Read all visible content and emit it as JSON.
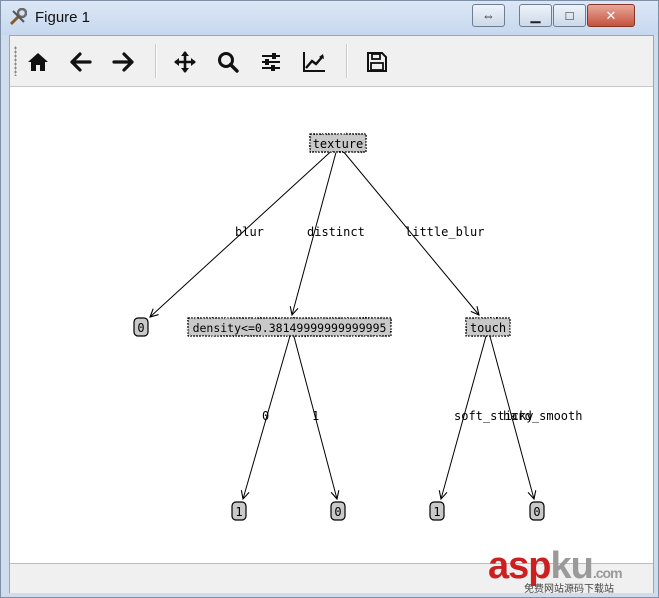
{
  "window": {
    "title": "Figure 1",
    "controls": {
      "restore_symbol": "⇔",
      "minimize_symbol": "▁",
      "maximize_symbol": "□",
      "close_symbol": "✕"
    }
  },
  "toolbar": {
    "items": [
      {
        "name": "home-icon"
      },
      {
        "name": "back-arrow-icon"
      },
      {
        "name": "forward-arrow-icon"
      },
      {
        "name": "pan-icon"
      },
      {
        "name": "zoom-icon"
      },
      {
        "name": "configure-subplots-icon"
      },
      {
        "name": "edit-axis-icon"
      },
      {
        "name": "save-icon"
      }
    ]
  },
  "tree": {
    "nodes": {
      "texture": "texture",
      "leaf_blur": "0",
      "density": "density<=0.38149999999999995",
      "touch": "touch",
      "leaf_d0": "1",
      "leaf_d1": "0",
      "leaf_t0": "1",
      "leaf_t1": "0"
    },
    "edges": {
      "blur": "blur",
      "distinct": "distinct",
      "little_blur": "little_blur",
      "d_0": "0",
      "d_1": "1",
      "soft_sticky": "soft_sticky",
      "hard_smooth": "hard_smooth"
    }
  },
  "watermark": {
    "asp": "asp",
    "ku": "ku",
    "dotcom": ".com",
    "sub": "免费网站源码下载站",
    "colors": {
      "red": "#cc1f1f",
      "grey": "#9a9a9a"
    }
  }
}
